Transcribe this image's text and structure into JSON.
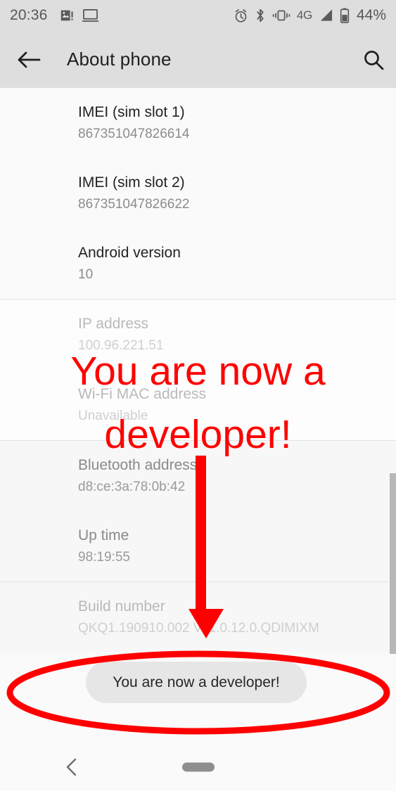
{
  "statusbar": {
    "time": "20:36",
    "left_icons": [
      "image-alert-icon",
      "cast-screen-icon"
    ],
    "right_icons": [
      "alarm-icon",
      "bluetooth-icon",
      "vibrate-icon"
    ],
    "network_type": "4G",
    "signal_icon": "signal-bars-icon",
    "battery_icon": "battery-icon",
    "battery_percent": "44%"
  },
  "appbar": {
    "back_icon": "arrow-left-icon",
    "title": "About phone",
    "search_icon": "search-icon"
  },
  "rows": [
    {
      "title": "IMEI (sim slot 1)",
      "value": "867351047826614"
    },
    {
      "title": "IMEI (sim slot 2)",
      "value": "867351047826622"
    },
    {
      "title": "Android version",
      "value": "10"
    },
    {
      "title": "IP address",
      "value": "100.96.221.51"
    },
    {
      "title": "Wi-Fi MAC address",
      "value": "Unavailable"
    },
    {
      "title": "Bluetooth address",
      "value": "d8:ce:3a:78:0b:42"
    },
    {
      "title": "Up time",
      "value": "98:19:55"
    },
    {
      "title": "Build number",
      "value": "QKQ1.190910.002 V11.0.12.0.QDIMIXM"
    }
  ],
  "toast": {
    "message": "You are now a developer!"
  },
  "annotation": {
    "line1": "You are now a",
    "line2": "developer!",
    "color": "#ff0000",
    "arrow": "down-arrow-annotation",
    "ellipse": "highlight-ellipse-annotation"
  },
  "navbar": {
    "back_icon": "nav-back-chevron-icon",
    "home_pill": "nav-home-pill"
  }
}
